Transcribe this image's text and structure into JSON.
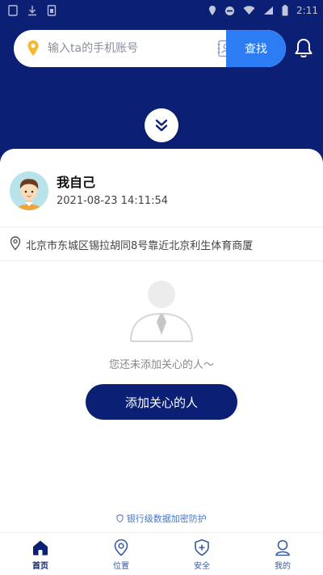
{
  "status_bar": {
    "time": "2:11"
  },
  "search": {
    "placeholder": "输入ta的手机账号",
    "button_label": "查找"
  },
  "user": {
    "name": "我自己",
    "timestamp": "2021-08-23 14:11:54",
    "location": "北京市东城区锡拉胡同8号靠近北京利生体育商厦"
  },
  "empty_state": {
    "message": "您还未添加关心的人～",
    "add_button_label": "添加关心的人"
  },
  "security_note": "银行级数据加密防护",
  "tabs": [
    {
      "label": "首页",
      "icon": "home-icon",
      "active": true
    },
    {
      "label": "位置",
      "icon": "location-icon",
      "active": false
    },
    {
      "label": "安全",
      "icon": "shield-icon",
      "active": false
    },
    {
      "label": "我的",
      "icon": "profile-icon",
      "active": false
    }
  ],
  "colors": {
    "primary_navy": "#0b1f75",
    "search_button_blue": "#2c7df4",
    "location_pin_yellow": "#f5b82e"
  }
}
